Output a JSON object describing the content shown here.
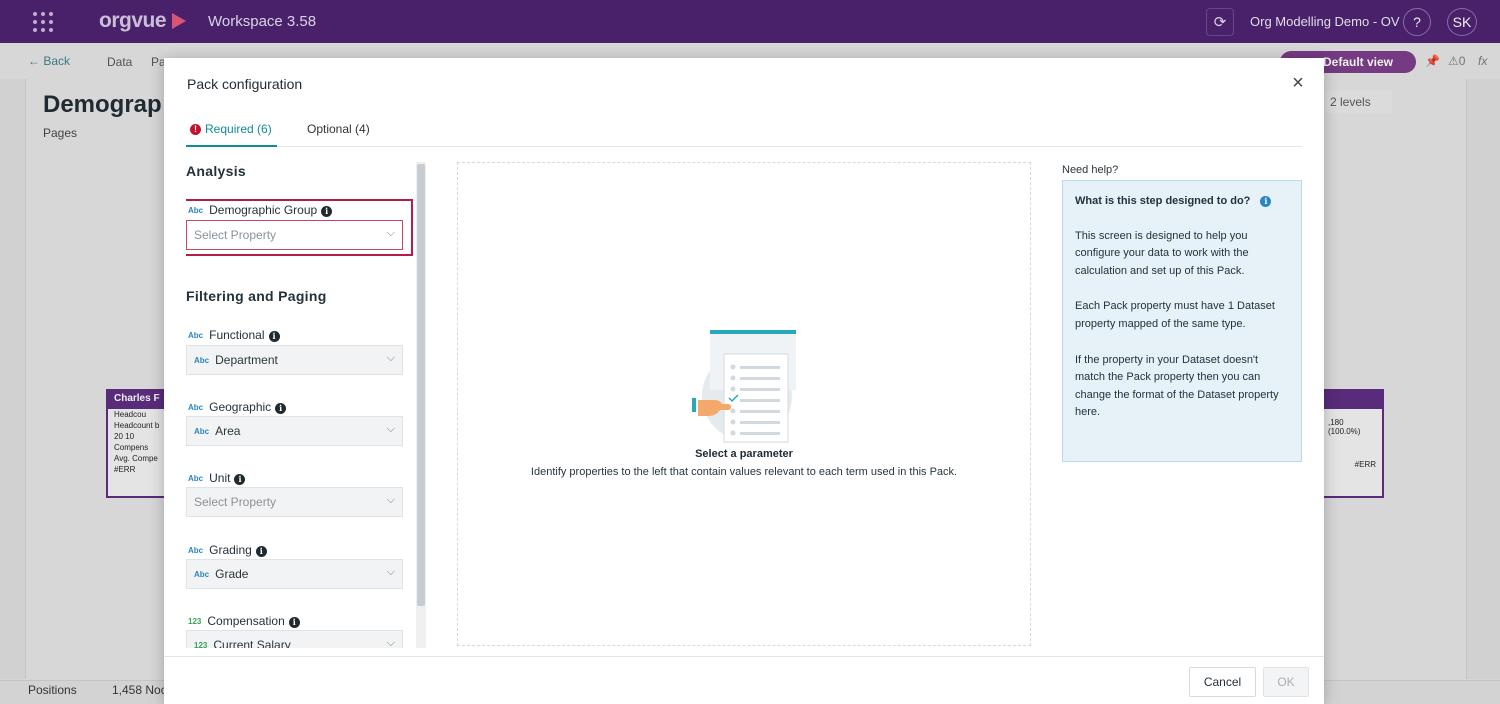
{
  "topbar": {
    "logo": "orgvue",
    "workspace": "Workspace  3.58",
    "project": "Org Modelling Demo - OV",
    "help": "?",
    "user_initials": "SK"
  },
  "background": {
    "back": "← Back",
    "data": "Data",
    "pa": "Pa",
    "view": "Default view",
    "alerts": "0",
    "fx": "fx",
    "title": "Demograp",
    "pages": "Pages",
    "levels": "2 levels",
    "card_left_name": "Charles F",
    "card_left_line1": "Headcou",
    "card_left_line2": "Headcount b",
    "card_left_line3": "20  10",
    "card_left_line4": "Compens",
    "card_left_line5": "Avg. Compe",
    "card_left_line6": "#ERR",
    "card_right_value": ",180 (100.0%)",
    "card_right_err": "#ERR",
    "positions": "Positions",
    "nodes": "1,458 Noc"
  },
  "modal": {
    "title": "Pack configuration",
    "close": "×",
    "tabs": [
      {
        "label": "Required (6)"
      },
      {
        "label": "Optional (4)"
      }
    ],
    "sections": {
      "analysis": "Analysis",
      "filtering": "Filtering and Paging"
    },
    "params": [
      {
        "type": "Abc",
        "label": "Demographic Group",
        "value": "Select Property"
      },
      {
        "type": "Abc",
        "label": "Functional",
        "value_type": "Abc",
        "value": "Department"
      },
      {
        "type": "Abc",
        "label": "Geographic",
        "value_type": "Abc",
        "value": "Area"
      },
      {
        "type": "Abc",
        "label": "Unit",
        "value": "Select Property"
      },
      {
        "type": "Abc",
        "label": "Grading",
        "value_type": "Abc",
        "value": "Grade"
      },
      {
        "type": "123",
        "label": "Compensation",
        "value_type": "123",
        "value": "Current Salary"
      }
    ],
    "center": {
      "title": "Select a parameter",
      "subtitle": "Identify properties to the left that contain values relevant to each term used in this Pack."
    },
    "help": {
      "heading": "Need help?",
      "question": "What is this step designed to do?",
      "p1": "This screen is designed to help you configure your data to work with the calculation and set up of this Pack.",
      "p2": "Each Pack property must have 1 Dataset property mapped of the same type.",
      "p3": "If the property in your Dataset doesn't match the Pack property then you can change the format of the Dataset property here."
    },
    "footer": {
      "cancel": "Cancel",
      "ok": "OK"
    }
  },
  "colors": {
    "topbar": "#4a1f6e",
    "accent": "#138a9c",
    "required": "#b71c46"
  }
}
